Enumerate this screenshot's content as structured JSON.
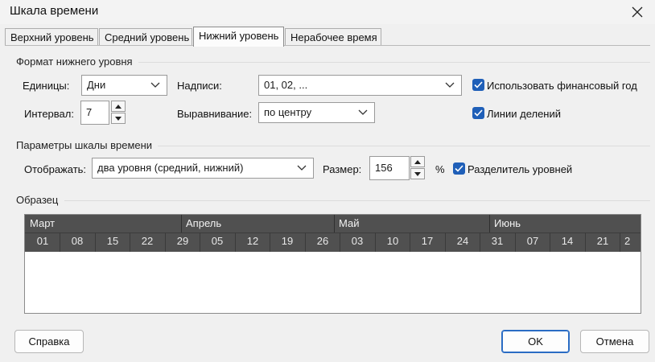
{
  "window": {
    "title": "Шкала времени"
  },
  "tabs": [
    {
      "label": "Верхний уровень",
      "active": false
    },
    {
      "label": "Средний уровень",
      "active": false
    },
    {
      "label": "Нижний уровень",
      "active": true
    },
    {
      "label": "Нерабочее время",
      "active": false
    }
  ],
  "format": {
    "section_title": "Формат нижнего уровня",
    "units_label": "Единицы:",
    "units_value": "Дни",
    "labels_label": "Надписи:",
    "labels_value": "01, 02, ...",
    "use_fiscal_label": "Использовать финансовый год",
    "use_fiscal_checked": true,
    "interval_label": "Интервал:",
    "interval_value": "7",
    "align_label": "Выравнивание:",
    "align_value": "по центру",
    "tick_lines_label": "Линии делений",
    "tick_lines_checked": true
  },
  "timescale_options": {
    "section_title": "Параметры шкалы времени",
    "show_label": "Отображать:",
    "show_value": "два уровня (средний, нижний)",
    "size_label": "Размер:",
    "size_value": "156",
    "percent": "%",
    "separator_label": "Разделитель уровней",
    "separator_checked": true
  },
  "preview": {
    "section_title": "Образец",
    "months": [
      "Март",
      "Апрель",
      "Май",
      "Июнь"
    ],
    "days": [
      "01",
      "08",
      "15",
      "22",
      "29",
      "05",
      "12",
      "19",
      "26",
      "03",
      "10",
      "17",
      "24",
      "31",
      "07",
      "14",
      "21",
      "2"
    ]
  },
  "buttons": {
    "help": "Справка",
    "ok": "OK",
    "cancel": "Отмена"
  },
  "colors": {
    "accent": "#1f5fb8",
    "scale_bg": "#505050"
  }
}
